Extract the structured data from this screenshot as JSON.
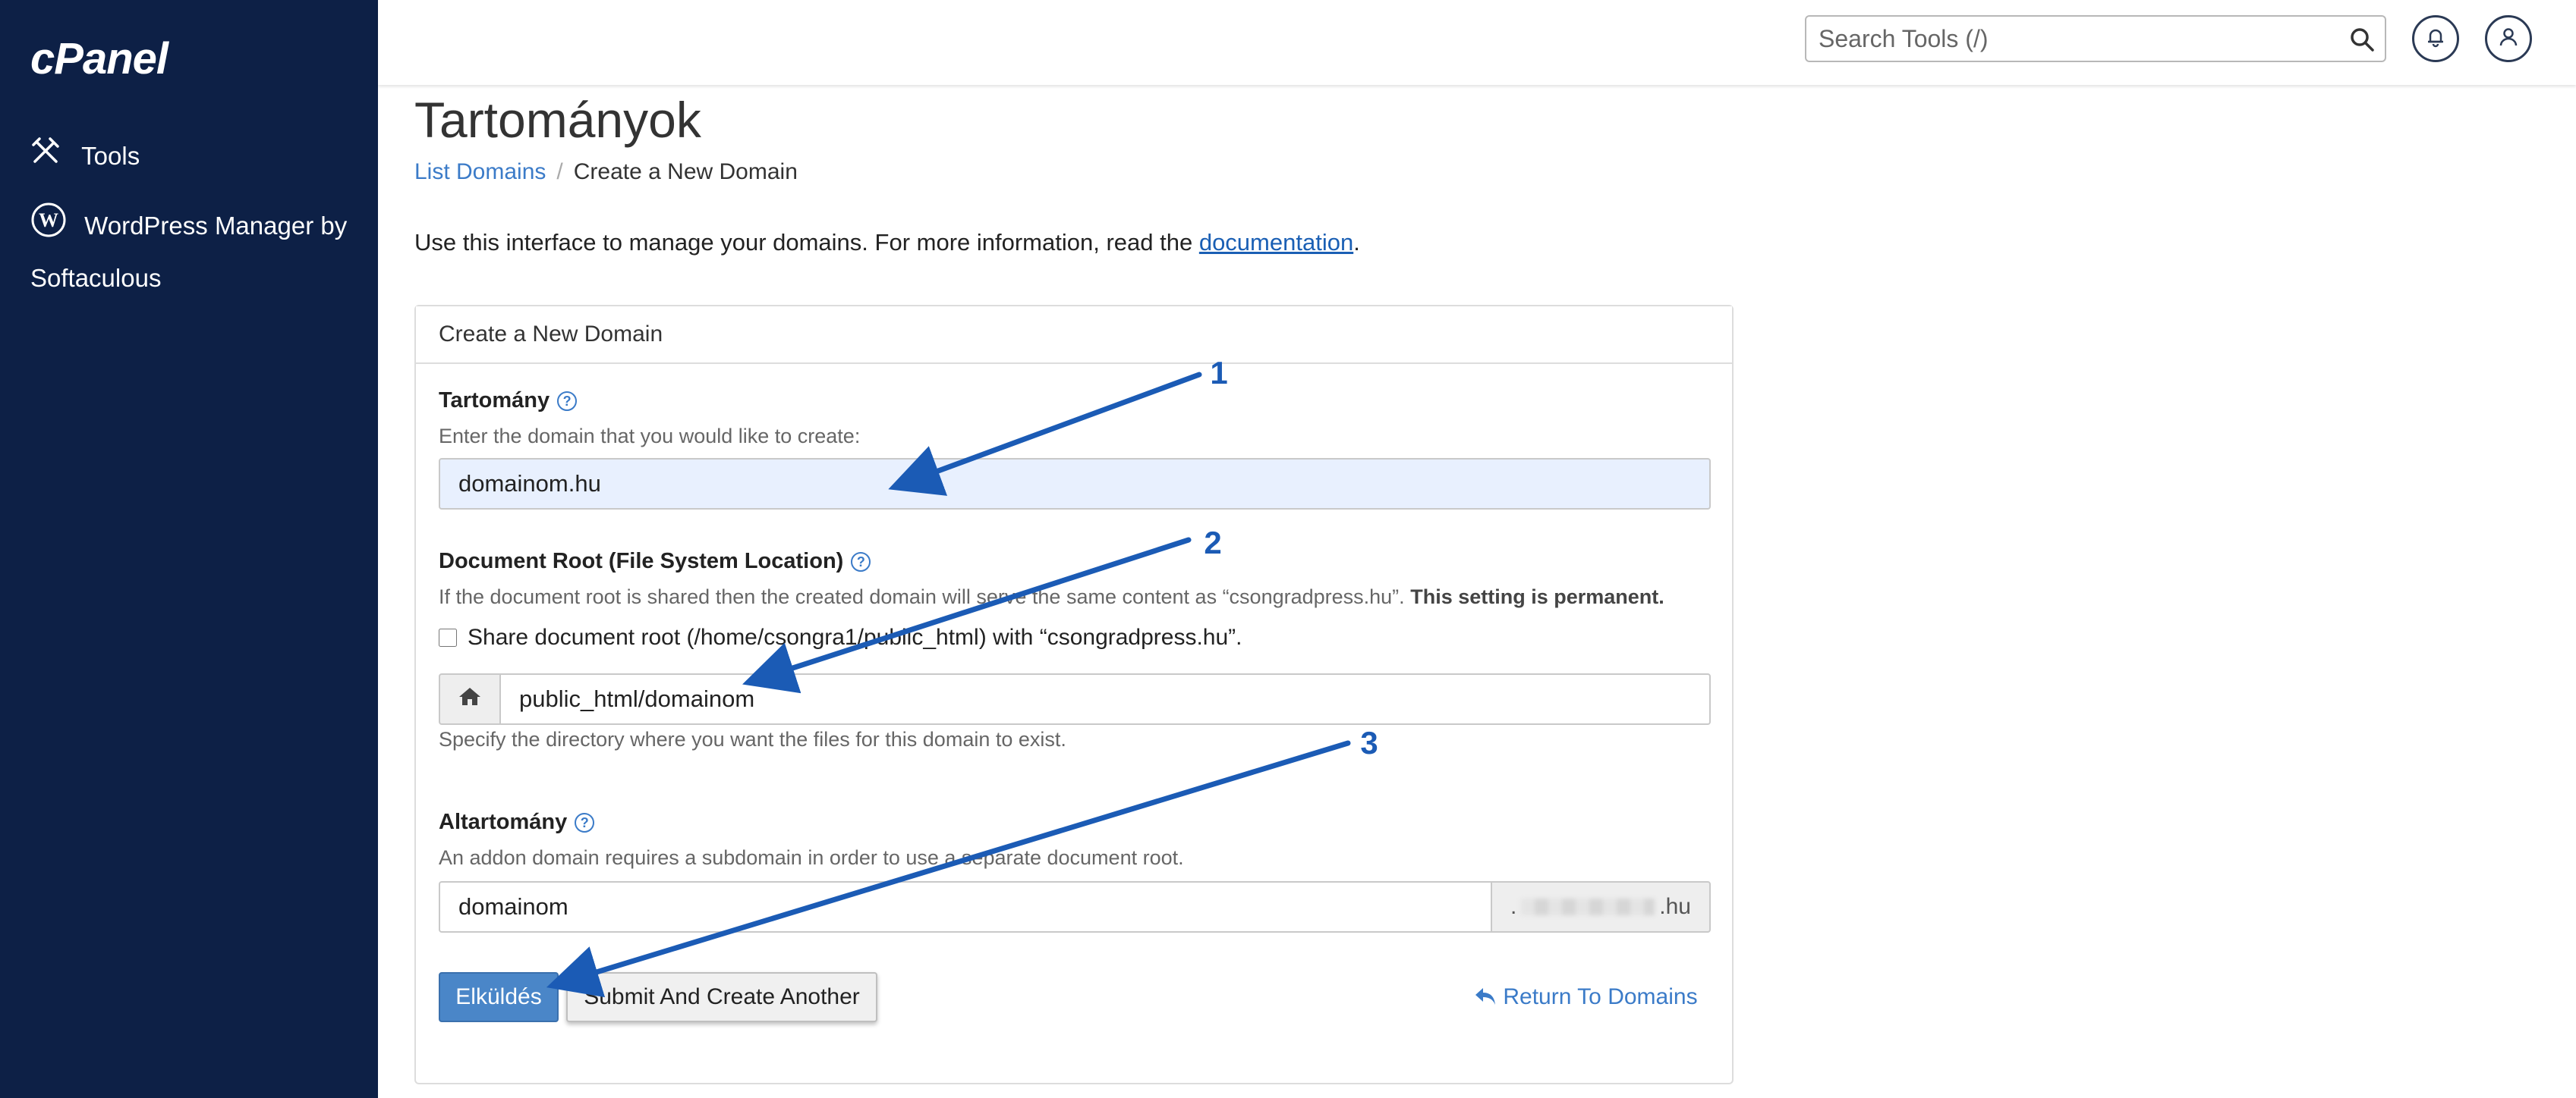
{
  "sidebar": {
    "logo": "cPanel",
    "items": [
      {
        "label": "Tools",
        "icon": "tools-icon"
      },
      {
        "label_line1": "WordPress Manager by",
        "label_line2": "Softaculous",
        "icon": "wordpress-icon"
      }
    ]
  },
  "header": {
    "search_placeholder": "Search Tools (/)",
    "icons": [
      "search-icon",
      "bell-icon",
      "user-icon"
    ]
  },
  "page": {
    "title": "Tartományok",
    "breadcrumb": {
      "link": "List Domains",
      "current": "Create a New Domain"
    },
    "intro_text": "Use this interface to manage your domains. For more information, read the ",
    "intro_link": "documentation",
    "intro_end": "."
  },
  "panel": {
    "title": "Create a New Domain",
    "domain": {
      "label": "Tartomány",
      "hint": "Enter the domain that you would like to create:",
      "value": "domainom.hu"
    },
    "docroot": {
      "label": "Document Root (File System Location)",
      "hint": "If the document root is shared then the created domain will serve the same content as “csongradpress.hu”.",
      "hint_bold": "This setting is permanent.",
      "checkbox_label": "Share document root (/home/csongra1/public_html) with “csongradpress.hu”.",
      "checked": false,
      "value": "public_html/domainom",
      "help_text": "Specify the directory where you want the files for this domain to exist."
    },
    "subdomain": {
      "label": "Altartomány",
      "hint": "An addon domain requires a subdomain in order to use a separate document root.",
      "value": "domainom",
      "suffix_start": ".",
      "suffix_end": ".hu"
    },
    "buttons": {
      "submit": "Elküldés",
      "submit_another": "Submit And Create Another",
      "return": "Return To Domains"
    }
  },
  "annotations": {
    "numbers": [
      "1",
      "2",
      "3"
    ],
    "color": "#1b5bb5"
  },
  "colors": {
    "sidebar_bg": "#0d2046",
    "link": "#3b7bc8",
    "primary_button": "#4a86c8"
  }
}
